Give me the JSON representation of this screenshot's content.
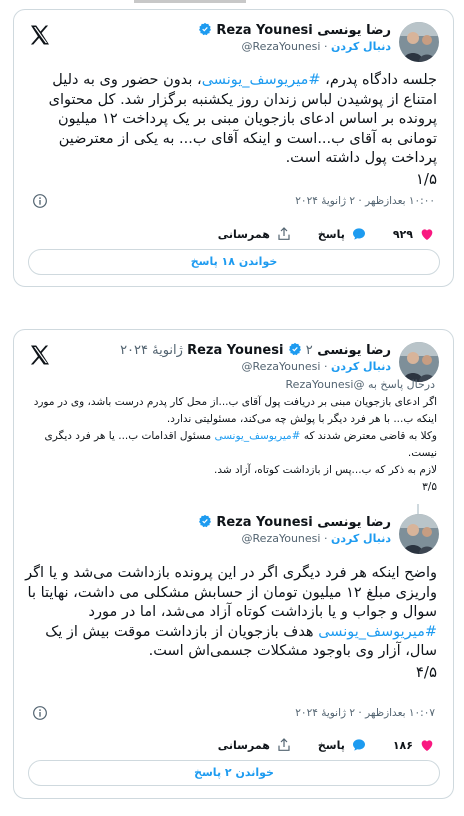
{
  "tweet1": {
    "display_name": "رضا یونسی Reza Younesi",
    "handle": "@RezaYounesi",
    "follow_label": "دنبال کردن",
    "text_prefix": "جلسه دادگاه پدرم، ",
    "hashtag": "#میریوسف_یونسی",
    "text_rest": "، بدون حضور وی به دلیل امتناع از پوشیدن لباس زندان روز یکشنبه برگزار شد. کل محتوای پرونده بر اساس ادعای بازجویان مبنی بر یک پرداخت ۱۲ میلیون تومانی به آقای ب...است و اینکه آقای ب... به یکی از معترضین پرداخت پول داشته است.",
    "counter": "۱/۵",
    "timestamp": "۱۰:۰۰ بعدازظهر · ۲ ژانویهٔ ۲۰۲۴",
    "likes": "۹۲۹",
    "reply_label": "پاسخ",
    "share_label": "همرسانی",
    "read_replies": "خواندن ۱۸ پاسخ"
  },
  "tweet2": {
    "display_name": "رضا یونسی Reza Younesi",
    "date": "۲ ژانویهٔ ۲۰۲۴",
    "handle": "@RezaYounesi",
    "follow_label": "دنبال کردن",
    "replying_to": "درحال پاسخ به @RezaYounesi",
    "quote_p1": "اگر ادعای بازجویان مبنی بر دریافت پول آقای ب...از محل کار پدرم درست باشد، وی در مورد اینکه ب... با هر فرد دیگر با پولش چه می‌کند، مسئولیتی ندارد.",
    "quote_p2_prefix": "وکلا به قاضی معترض شدند که ",
    "quote_p2_hashtag": "#میریوسف_یونسی",
    "quote_p2_rest": " مسئول اقدامات ب... یا هر فرد دیگری نیست.",
    "quote_p3": "لازم به ذکر که ب...پس از بازداشت کوتاه، آزاد شد.",
    "quote_counter": "۳/۵",
    "reply_display_name": "رضا یونسی Reza Younesi",
    "reply_handle": "@RezaYounesi",
    "reply_follow_label": "دنبال کردن",
    "text_a": "واضح اینکه هر فرد دیگری اگر در این پرونده بازداشت می‌شد و یا اگر واریزی مبلغ ۱۲ میلیون تومان از حسابش مشکلی می داشت، نهایتا با سوال و جواب و یا بازداشت کوتاه آزاد می‌شد، اما در مورد ",
    "hashtag": "#میریوسف_یونسی",
    "text_b": " هدف بازجویان از بازداشت موقت بیش از یک سال، آزار وی باوجود مشکلات جسمی‌اش است.",
    "counter": "۴/۵",
    "timestamp": "۱۰:۰۷ بعدازظهر · ۲ ژانویهٔ ۲۰۲۴",
    "likes": "۱۸۶",
    "reply_label": "پاسخ",
    "share_label": "همرسانی",
    "read_replies": "خواندن ۲ پاسخ"
  },
  "colors": {
    "accent": "#1d9bf0",
    "like": "#f91880",
    "text": "#0f1419",
    "muted": "#536471",
    "border": "#cfd9de"
  },
  "icons": [
    "x-logo-icon",
    "verified-badge-icon",
    "info-icon",
    "heart-icon",
    "reply-icon",
    "share-icon",
    "link-icon"
  ]
}
